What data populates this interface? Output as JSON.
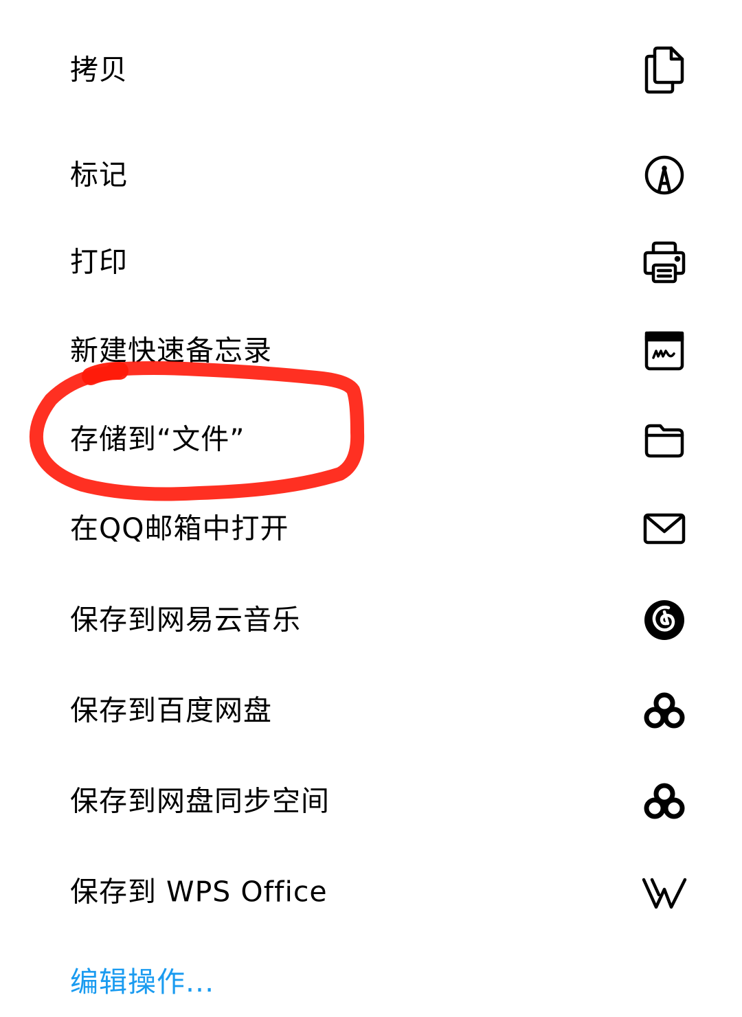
{
  "accent_color": "#1a9bf0",
  "highlight_color": "#ff1a0a",
  "actions": [
    {
      "label": "拷贝",
      "icon": "copy-icon"
    },
    {
      "label": "标记",
      "icon": "markup-icon"
    },
    {
      "label": "打印",
      "icon": "print-icon"
    },
    {
      "label": "新建快速备忘录",
      "icon": "quick-note-icon"
    },
    {
      "label": "存储到“文件”",
      "icon": "folder-icon"
    },
    {
      "label": "在QQ邮箱中打开",
      "icon": "mail-icon"
    },
    {
      "label": "保存到网易云音乐",
      "icon": "netease-music-icon"
    },
    {
      "label": "保存到百度网盘",
      "icon": "baidu-netdisk-icon"
    },
    {
      "label": "保存到网盘同步空间",
      "icon": "baidu-sync-icon"
    },
    {
      "label": "保存到 WPS Office",
      "icon": "wps-icon"
    }
  ],
  "edit_actions_label": "编辑操作..."
}
